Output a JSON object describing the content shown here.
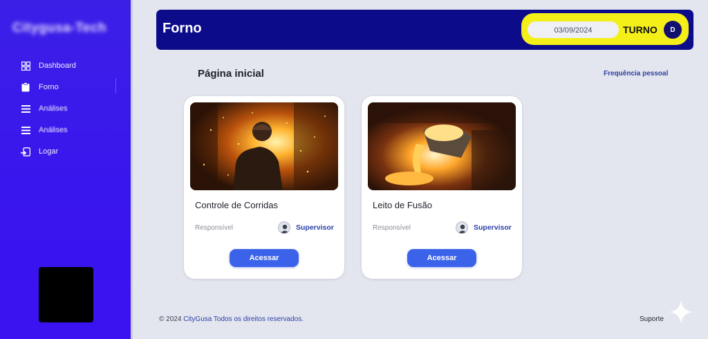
{
  "sidebar": {
    "brand": "Citygusa-Tech",
    "items": [
      {
        "label": "Dashboard",
        "icon": "grid-icon"
      },
      {
        "label": "Forno",
        "icon": "clipboard-icon"
      },
      {
        "label": "Análises",
        "icon": "list-icon"
      },
      {
        "label": "Análises",
        "icon": "list-icon"
      },
      {
        "label": "Logar",
        "icon": "login-icon"
      }
    ]
  },
  "header": {
    "title": "Forno",
    "date": "03/09/2024",
    "turno_label": "TURNO",
    "avatar_initial": "D"
  },
  "main": {
    "page_title": "Página inicial",
    "freq_link": "Frequência pessoal",
    "cards": [
      {
        "title": "Controle de Corridas",
        "resp_label": "Responsível",
        "supervisor": "Supervisor",
        "button": "Acessar"
      },
      {
        "title": "Leito de Fusão",
        "resp_label": "Responsível",
        "supervisor": "Supervisor",
        "button": "Acessar"
      }
    ]
  },
  "footer": {
    "copyright": "© 2024",
    "brand": "CityGusa Todos os direitos reservados.",
    "support": "Suporte"
  },
  "colors": {
    "sidebar": "#3b16ee",
    "header": "#0c0b8a",
    "turno": "#f4ef19",
    "button": "#3b63ea"
  }
}
